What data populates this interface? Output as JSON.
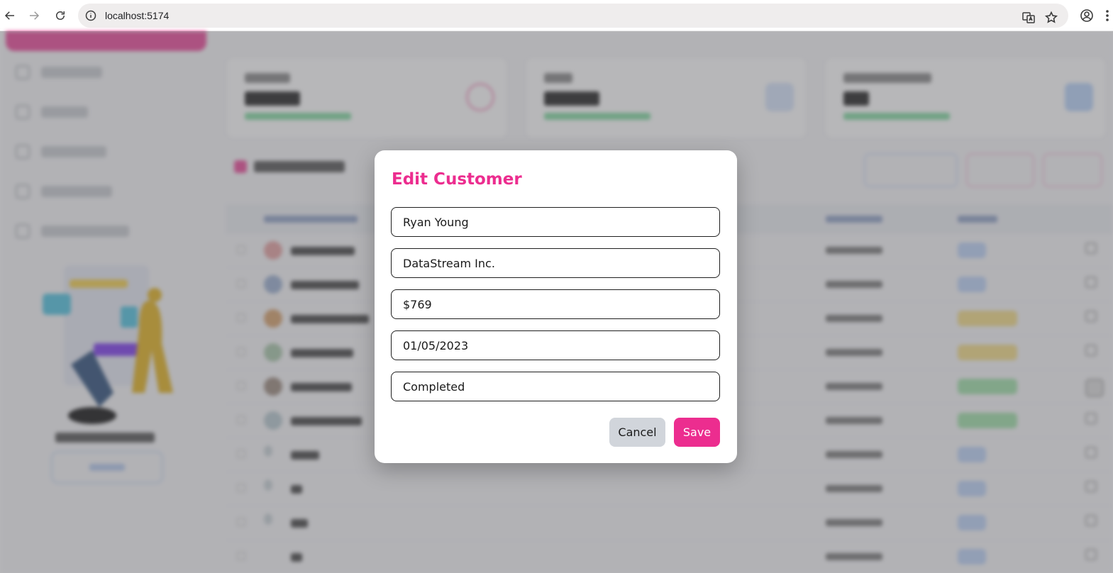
{
  "browser": {
    "url": "localhost:5174"
  },
  "modal": {
    "title": "Edit Customer",
    "fields": {
      "name": "Ryan Young",
      "company": "DataStream Inc.",
      "amount": "$769",
      "date": "01/05/2023",
      "status": "Completed"
    },
    "cancel_label": "Cancel",
    "save_label": "Save"
  },
  "colors": {
    "accent": "#ec2d8f",
    "cancel_bg": "#d1d5db",
    "success": "#22c55e"
  },
  "icons": [
    "back-arrow-icon",
    "forward-arrow-icon",
    "reload-icon",
    "site-info-icon",
    "translate-icon",
    "bookmark-star-icon",
    "profile-icon",
    "menu-kebab-icon"
  ]
}
